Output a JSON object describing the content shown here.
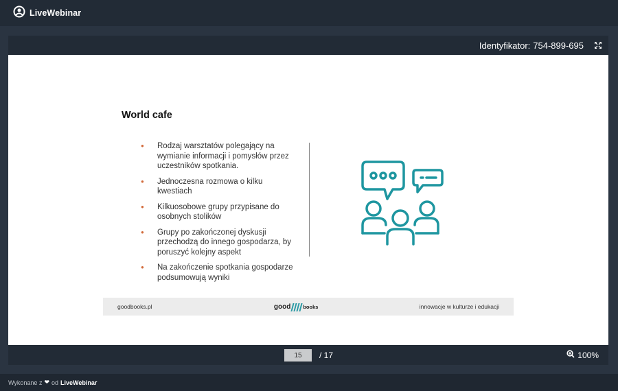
{
  "app": {
    "name": "LiveWebinar"
  },
  "viewer": {
    "meeting_id_label": "Identyfikator:",
    "meeting_id_value": "754-899-695"
  },
  "slide": {
    "title": "World cafe",
    "bullets": [
      "Rodzaj warsztatów polegający na wymianie informacji i pomysłów przez uczestników spotkania.",
      "Jednoczesna rozmowa o kilku kwestiach",
      "Kilkuosobowe grupy przypisane do osobnych stolików",
      "Grupy po zakończonej dyskusji przechodzą do innego gospodarza, by poruszyć kolejny aspekt",
      "Na zakończenie spotkania gospodarze podsumowują wyniki"
    ],
    "footer": {
      "left": "goodbooks.pl",
      "brand_part1": "good",
      "brand_part2": "books",
      "right": "innowacje w kulturze i edukacji"
    },
    "bullet_color": "#d26a3a",
    "icon_color": "#1e96a0"
  },
  "pager": {
    "current_page": "15",
    "total_label": "/ 17"
  },
  "zoom": {
    "level": "100%"
  },
  "footer_bar": {
    "made_with": "Wykonane z",
    "by": "od",
    "brand": "LiveWebinar"
  }
}
